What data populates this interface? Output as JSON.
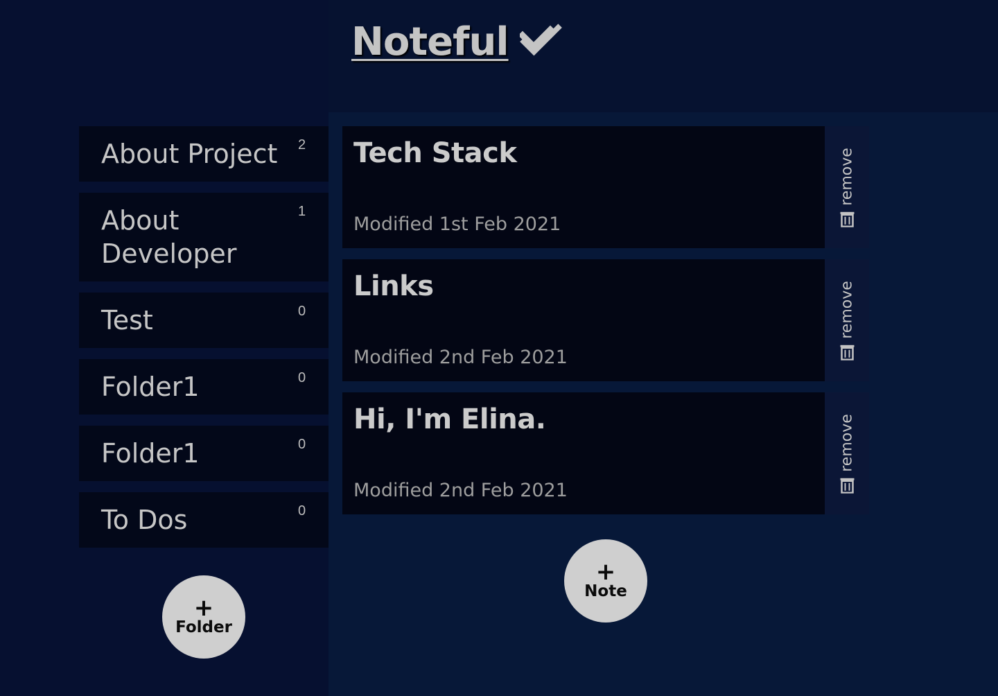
{
  "header": {
    "title": "Noteful",
    "title_icon": "double-check-icon"
  },
  "sidebar": {
    "folders": [
      {
        "name": "About Project",
        "count": "2"
      },
      {
        "name": "About Developer",
        "count": "1"
      },
      {
        "name": "Test",
        "count": "0"
      },
      {
        "name": "Folder1",
        "count": "0"
      },
      {
        "name": "Folder1",
        "count": "0"
      },
      {
        "name": "To Dos",
        "count": "0"
      }
    ],
    "add_button": {
      "plus": "+",
      "label": "Folder"
    }
  },
  "main": {
    "notes": [
      {
        "title": "Tech Stack",
        "modified": "Modified 1st Feb 2021",
        "remove_label": "remove",
        "remove_icon": "trash-icon"
      },
      {
        "title": "Links",
        "modified": "Modified 2nd Feb 2021",
        "remove_label": "remove",
        "remove_icon": "trash-icon"
      },
      {
        "title": "Hi, I'm Elina.",
        "modified": "Modified 2nd Feb 2021",
        "remove_label": "remove",
        "remove_icon": "trash-icon"
      }
    ],
    "add_button": {
      "plus": "+",
      "label": "Note"
    }
  },
  "colors": {
    "sidebar_bg": "#061030",
    "main_bg": "#071838",
    "card_bg": "#030614",
    "button_bg": "#cfcfcf",
    "text": "#c6c6c6"
  }
}
